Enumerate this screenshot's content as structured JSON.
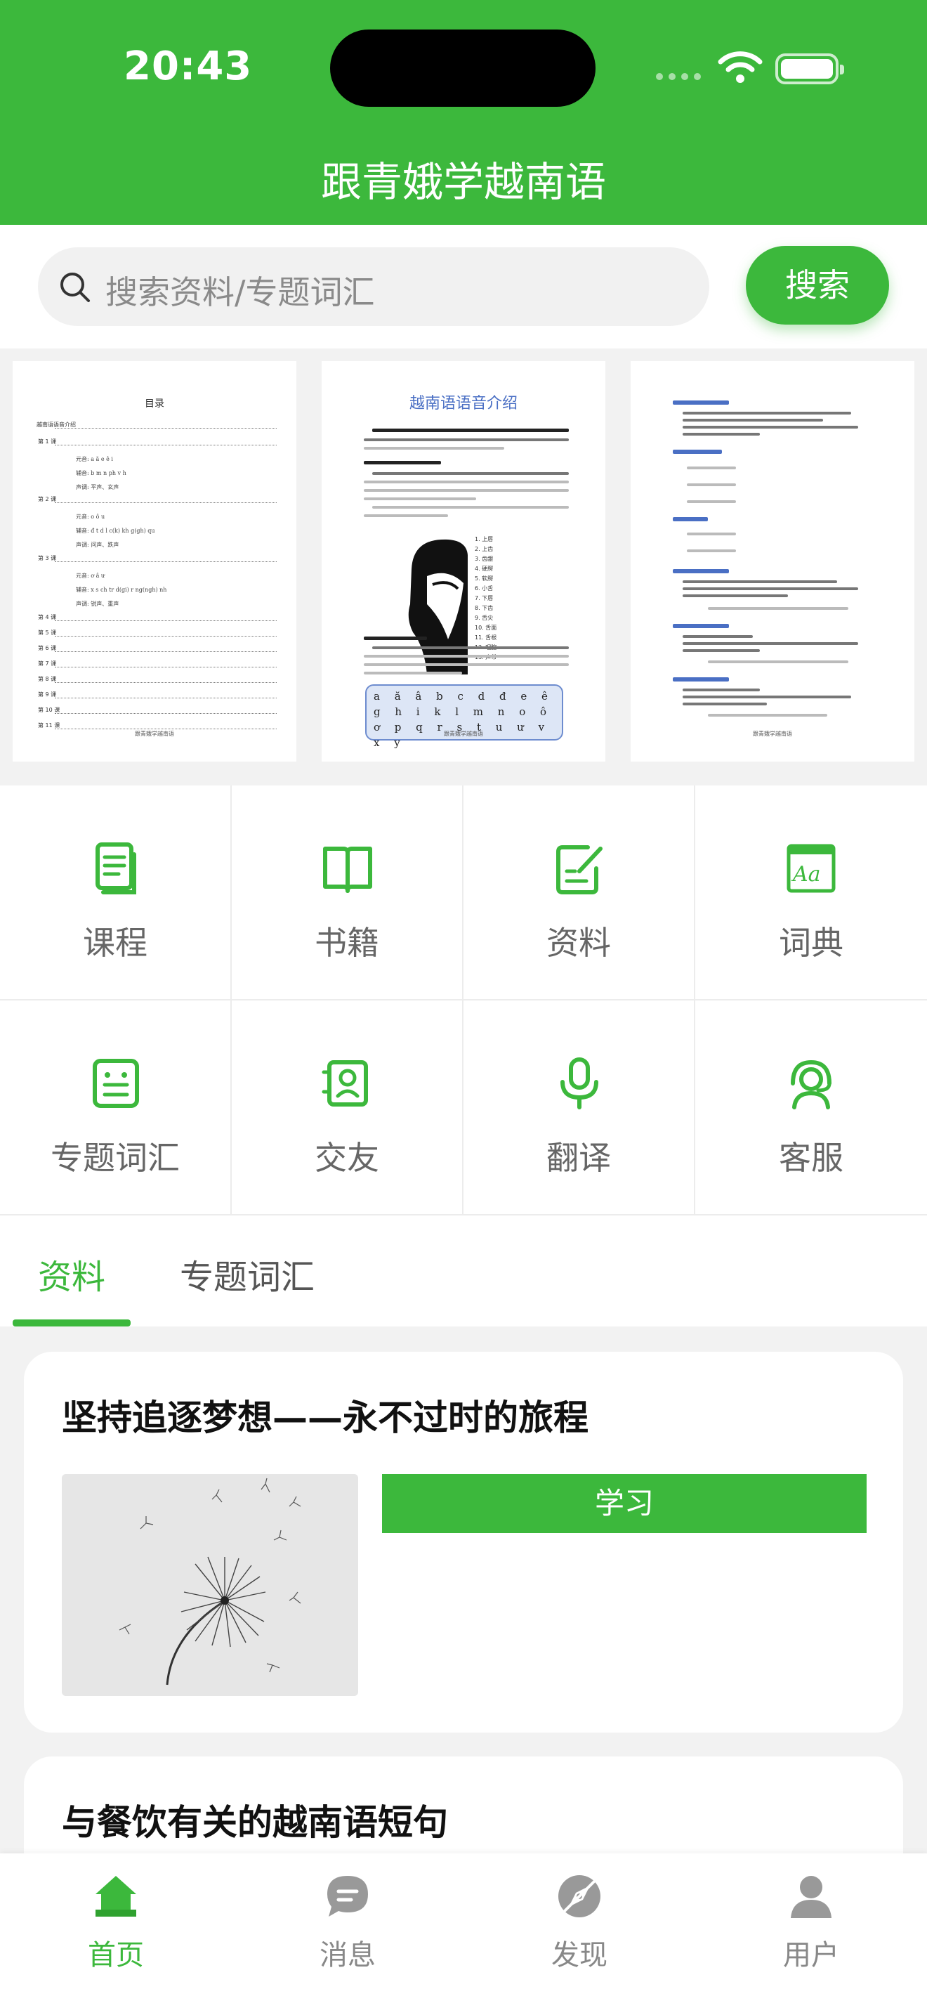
{
  "status_bar": {
    "time": "20:43"
  },
  "header": {
    "title": "跟青娥学越南语"
  },
  "search": {
    "placeholder": "搜索资料/专题词汇",
    "button_label": "搜索"
  },
  "banner": {
    "doc1": {
      "title": "目录",
      "rows": [
        "越南语语音介绍",
        "第 1 课",
        "第 2 课",
        "第 3 课",
        "第 4 课",
        "第 5 课",
        "第 6 课",
        "第 7 课",
        "第 8 课",
        "第 9 课",
        "第 10 课",
        "第 11 课"
      ],
      "footer": "跟青娥学越南语"
    },
    "doc2": {
      "title": "越南语语音介绍",
      "alphabet": "a ă â b c d đ e ê g h i k l m n o ô ơ p q r s t u ư v x y",
      "footer": "跟青娥学越南语"
    },
    "doc3": {
      "footer": "跟青娥学越南语"
    }
  },
  "grid": [
    {
      "label": "课程",
      "icon": "course-doc-icon"
    },
    {
      "label": "书籍",
      "icon": "book-icon"
    },
    {
      "label": "资料",
      "icon": "edit-doc-icon"
    },
    {
      "label": "词典",
      "icon": "dictionary-icon"
    },
    {
      "label": "专题词汇",
      "icon": "vocabulary-icon"
    },
    {
      "label": "交友",
      "icon": "friends-icon"
    },
    {
      "label": "翻译",
      "icon": "microphone-icon"
    },
    {
      "label": "客服",
      "icon": "customer-service-icon"
    }
  ],
  "tabs": [
    {
      "label": "资料",
      "active": true
    },
    {
      "label": "专题词汇",
      "active": false
    }
  ],
  "cards": [
    {
      "title": "坚持追逐梦想——永不过时的旅程",
      "button_label": "学习"
    },
    {
      "title": "与餐饮有关的越南语短句"
    }
  ],
  "bottom_nav": [
    {
      "label": "首页",
      "icon": "home-icon",
      "active": true
    },
    {
      "label": "消息",
      "icon": "message-icon",
      "active": false
    },
    {
      "label": "发现",
      "icon": "discover-icon",
      "active": false
    },
    {
      "label": "用户",
      "icon": "user-icon",
      "active": false
    }
  ],
  "colors": {
    "accent": "#3cb83c",
    "background": "#f2f2f2"
  }
}
